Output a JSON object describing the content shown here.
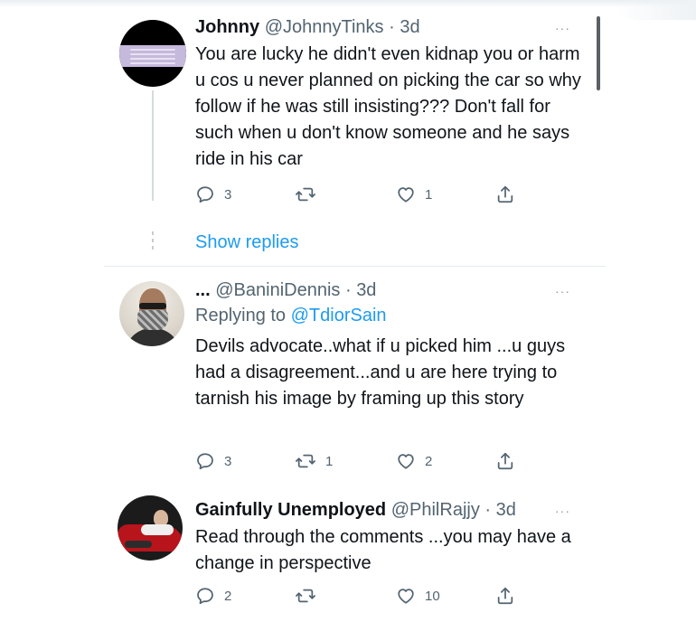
{
  "tweets": [
    {
      "name": "Johnny",
      "handle": "@JohnnyTinks",
      "separator": "·",
      "time": "3d",
      "more": "···",
      "replying_label": "",
      "replying_to": "",
      "text": "You are lucky he didn't even kidnap you or harm u cos u never planned on picking the car so why follow if he was still insisting??? Don't fall for such when u don't know someone and he says ride in his car",
      "replies": "3",
      "retweets": "",
      "likes": "1"
    },
    {
      "name": "...",
      "handle": "@BaniniDennis",
      "separator": "·",
      "time": "3d",
      "more": "···",
      "replying_label": "Replying to",
      "replying_to": "@TdiorSain",
      "text": "Devils advocate..what if u picked him ...u guys had a disagreement...and u are here trying to tarnish his image by framing up this story",
      "replies": "3",
      "retweets": "1",
      "likes": "2"
    },
    {
      "name": "Gainfully Unemployed",
      "handle": "@PhilRajjy",
      "separator": "·",
      "time": "3d",
      "more": "···",
      "replying_label": "",
      "replying_to": "",
      "text": "Read through the comments ...you may have a change in perspective",
      "replies": "2",
      "retweets": "",
      "likes": "10"
    }
  ],
  "show_replies": "Show replies",
  "icons": {
    "reply": "reply-icon",
    "retweet": "retweet-icon",
    "like": "like-icon",
    "share": "share-icon",
    "more": "more-icon"
  },
  "colors": {
    "link": "#1d9bf0",
    "secondary_text": "#536471",
    "primary_text": "#0f1419"
  }
}
